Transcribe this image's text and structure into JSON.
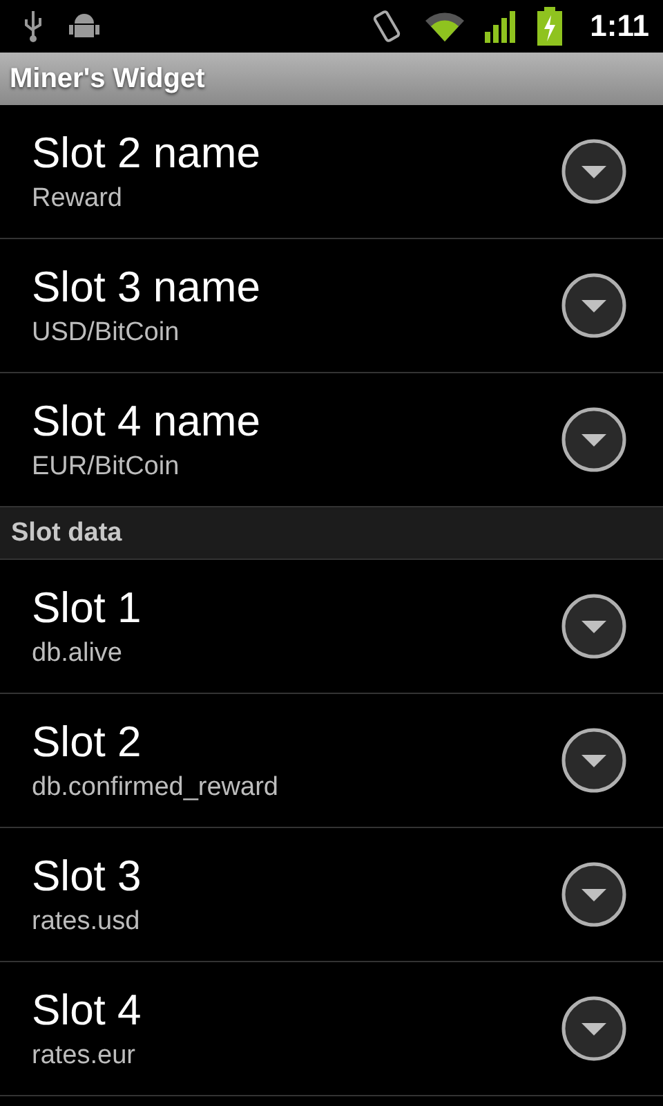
{
  "status_bar": {
    "time": "1:11"
  },
  "title_bar": {
    "title": "Miner's Widget"
  },
  "sections": [
    {
      "items": [
        {
          "title": "Slot 2 name",
          "summary": "Reward"
        },
        {
          "title": "Slot 3 name",
          "summary": "USD/BitCoin"
        },
        {
          "title": "Slot 4 name",
          "summary": "EUR/BitCoin"
        }
      ]
    },
    {
      "header": "Slot data",
      "items": [
        {
          "title": "Slot 1",
          "summary": "db.alive"
        },
        {
          "title": "Slot 2",
          "summary": "db.confirmed_reward"
        },
        {
          "title": "Slot 3",
          "summary": "rates.usd"
        },
        {
          "title": "Slot 4",
          "summary": "rates.eur"
        }
      ]
    }
  ]
}
